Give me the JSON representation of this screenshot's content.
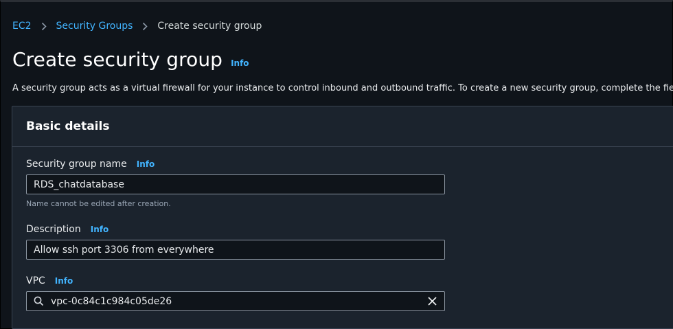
{
  "breadcrumb": {
    "items": [
      "EC2",
      "Security Groups"
    ],
    "current": "Create security group"
  },
  "header": {
    "title": "Create security group",
    "info": "Info",
    "description": "A security group acts as a virtual firewall for your instance to control inbound and outbound traffic. To create a new security group, complete the fields b"
  },
  "basic_details": {
    "title": "Basic details",
    "name": {
      "label": "Security group name",
      "info": "Info",
      "value": "RDS_chatdatabase",
      "hint": "Name cannot be edited after creation."
    },
    "description": {
      "label": "Description",
      "info": "Info",
      "value": "Allow ssh port 3306 from everywhere"
    },
    "vpc": {
      "label": "VPC",
      "info": "Info",
      "value": "vpc-0c84c1c984c05de26"
    }
  },
  "icons": {
    "breadcrumb_separator": "chevron-right-icon",
    "vpc_search": "search-icon",
    "vpc_clear": "close-icon"
  },
  "colors": {
    "link": "#42b4ff",
    "background": "#0f141a",
    "panel": "#1b232d"
  }
}
